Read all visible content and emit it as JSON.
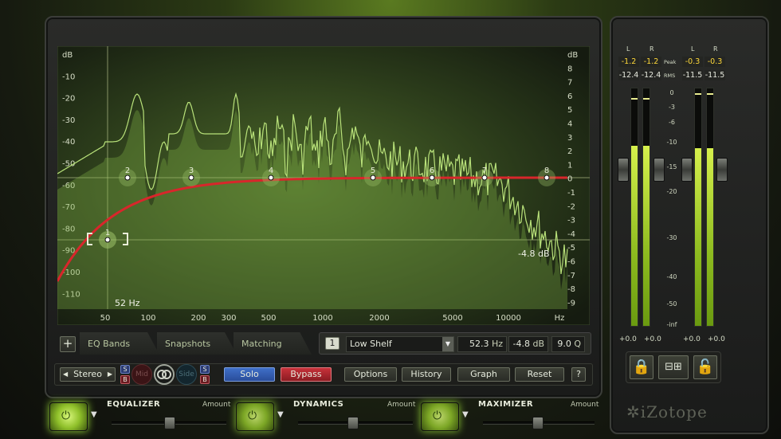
{
  "graph": {
    "db_left": [
      "dB",
      "-10",
      "-20",
      "-30",
      "-40",
      "-50",
      "-60",
      "-70",
      "-80",
      "-90",
      "-100",
      "-110"
    ],
    "db_right": [
      "dB",
      "8",
      "7",
      "6",
      "5",
      "4",
      "3",
      "2",
      "1",
      "0",
      "-1",
      "-2",
      "-3",
      "-4",
      "-5",
      "-6",
      "-7",
      "-8",
      "-9"
    ],
    "freq_labels": [
      "50",
      "100",
      "200",
      "300",
      "500",
      "1000",
      "2000",
      "5000",
      "10000",
      "Hz"
    ],
    "cursor_freq": "52 Hz",
    "gain_readout": "-4.8 dB",
    "nodes": [
      "1",
      "2",
      "3",
      "4",
      "5",
      "6",
      "7",
      "8"
    ],
    "curve_color": "#d8262b",
    "spectrum_color": "#b9e27a"
  },
  "tabs": [
    "EQ Bands",
    "Snapshots",
    "Matching"
  ],
  "band": {
    "number": "1",
    "type": "Low Shelf",
    "freq_value": "52.3",
    "freq_unit": "Hz",
    "gain_value": "-4.8",
    "gain_unit": "dB",
    "q_value": "9.0",
    "q_unit": "Q"
  },
  "toolbar": {
    "add": "+",
    "stereo": "Stereo",
    "s": "S",
    "b": "B",
    "mid": "Mid",
    "side": "Side",
    "solo": "Solo",
    "bypass": "Bypass",
    "options": "Options",
    "history": "History",
    "graph": "Graph",
    "reset": "Reset",
    "help": "?"
  },
  "meters": {
    "in_l": "L",
    "in_r": "R",
    "out_l": "L",
    "out_r": "R",
    "peak_label": "Peak",
    "rms_label": "RMS",
    "in_peak_l": "-1.2",
    "in_peak_r": "-1.2",
    "out_peak_l": "-0.3",
    "out_peak_r": "-0.3",
    "in_rms_l": "-12.4",
    "in_rms_r": "-12.4",
    "out_rms_l": "-11.5",
    "out_rms_r": "-11.5",
    "scale": [
      "0",
      "-3",
      "-6",
      "-10",
      "-15",
      "-20",
      "-30",
      "-40",
      "-50",
      "-inf"
    ],
    "in_gain_l": "+0.0",
    "in_gain_r": "+0.0",
    "out_gain_l": "+0.0",
    "out_gain_r": "+0.0",
    "brand": "iZotope"
  },
  "modules": [
    {
      "title": "EQUALIZER",
      "amount": "Amount",
      "power": "on"
    },
    {
      "title": "DYNAMICS",
      "amount": "Amount",
      "power": "on"
    },
    {
      "title": "MAXIMIZER",
      "amount": "Amount",
      "power": "on"
    }
  ]
}
